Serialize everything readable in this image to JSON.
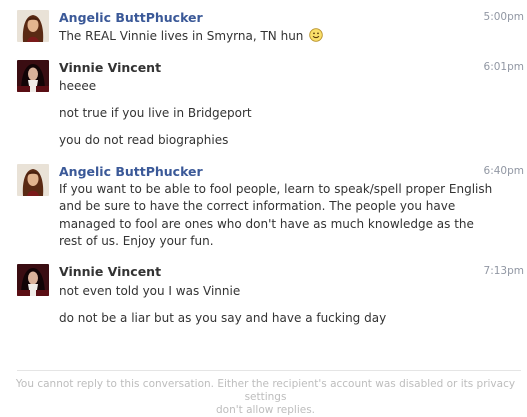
{
  "messages": [
    {
      "sender": "Angelic ButtPhucker",
      "time": "5:00pm",
      "avatar_icon": "woman-portrait-icon",
      "lines": [
        "The REAL Vinnie lives in Smyrna, TN hun"
      ],
      "emoticon": "smiley-icon"
    },
    {
      "sender": "Vinnie Vincent",
      "time": "6:01pm",
      "avatar_icon": "man-portrait-icon",
      "lines": [
        "heeee",
        "not true if you live in Bridgeport",
        "you do not read biographies"
      ]
    },
    {
      "sender": "Angelic ButtPhucker",
      "time": "6:40pm",
      "avatar_icon": "woman-portrait-icon",
      "paragraph_lines": [
        "If you want to be able to fool people, learn to speak/spell proper English",
        "and be sure to have the correct information. The people you have",
        "managed to fool are ones who don't have as much knowledge as the",
        "rest of us. Enjoy your fun."
      ]
    },
    {
      "sender": "Vinnie Vincent",
      "time": "7:13pm",
      "avatar_icon": "man-portrait-icon",
      "lines": [
        "not even told you I was Vinnie",
        "do not be a liar but as you say and have a fucking day"
      ]
    }
  ],
  "footer": {
    "line1": "You cannot reply to this conversation. Either the recipient's account was disabled or its privacy settings",
    "line2": "don't allow replies."
  },
  "colors": {
    "link_blue": "#3b5998",
    "timestamp_gray": "#9197a3",
    "footer_gray": "#bdbdbd"
  }
}
